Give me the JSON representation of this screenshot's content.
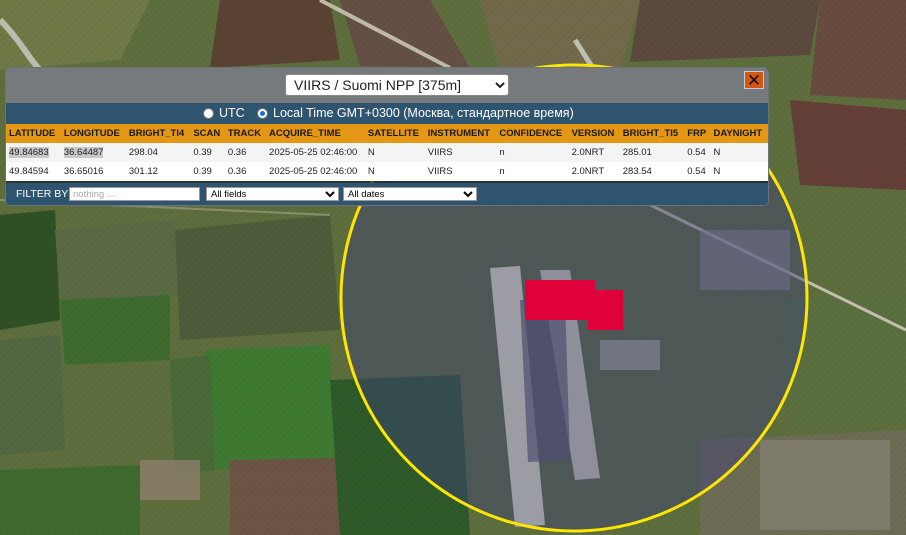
{
  "layer_selector": {
    "selected": "VIIRS / Suomi NPP [375m]"
  },
  "close_glyph": "✕",
  "timezone": {
    "utc_label": "UTC",
    "local_label": "Local Time GMT+0300 (Москва, стандартное время)",
    "selected": "local"
  },
  "table": {
    "columns": [
      "LATITUDE",
      "LONGITUDE",
      "BRIGHT_TI4",
      "SCAN",
      "TRACK",
      "ACQUIRE_TIME",
      "SATELLITE",
      "INSTRUMENT",
      "CONFIDENCE",
      "VERSION",
      "BRIGHT_TI5",
      "FRP",
      "DAYNIGHT"
    ],
    "rows": [
      [
        "49.84683",
        "36.64487",
        "298.04",
        "0.39",
        "0.36",
        "2025-05-25 02:46:00",
        "N",
        "VIIRS",
        "n",
        "2.0NRT",
        "285.01",
        "0.54",
        "N"
      ],
      [
        "49.84594",
        "36.65016",
        "301.12",
        "0.39",
        "0.36",
        "2025-05-25 02:46:00",
        "N",
        "VIIRS",
        "n",
        "2.0NRT",
        "283.54",
        "0.54",
        "N"
      ]
    ]
  },
  "filter": {
    "label": "FILTER BY",
    "placeholder": "nothing ...",
    "field_select": "All fields",
    "date_select": "All dates"
  },
  "colors": {
    "popup_header": "#777a7c",
    "bar_blue": "#2e5470",
    "table_header": "#e39715",
    "close_button": "#d6550f",
    "fire_marker": "#e0003a",
    "circle_outline": "#ffe600"
  }
}
